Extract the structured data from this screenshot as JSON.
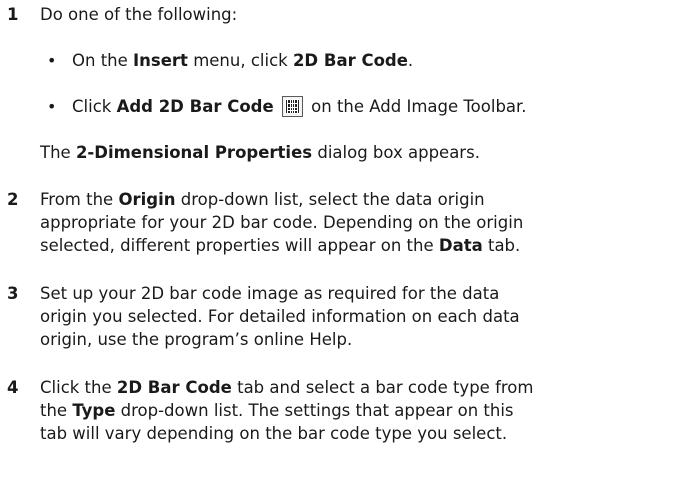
{
  "step1": {
    "number": "1",
    "text": "Do one of the following:",
    "bullet_symbol": "•",
    "bullet_a": {
      "part1": "On the ",
      "bold1": "Insert",
      "part2": " menu, click ",
      "bold2": "2D Bar Code",
      "part3": "."
    },
    "bullet_b": {
      "part1": "Click ",
      "bold1": "Add 2D Bar Code",
      "icon": "barcode-icon",
      "part2": " on the Add Image Toolbar."
    },
    "after": {
      "part1": "The ",
      "bold1": "2-Dimensional Properties",
      "part2": " dialog box appears."
    }
  },
  "step2": {
    "number": "2",
    "line1": {
      "part1": "From the ",
      "bold1": "Origin",
      "part2": " drop-down list, select the data origin"
    },
    "line2": "appropriate for your 2D bar code. Depending on the origin",
    "line3": {
      "part1": "selected, different properties will appear on the ",
      "bold1": "Data",
      "part2": " tab."
    }
  },
  "step3": {
    "number": "3",
    "line1": "Set up your 2D bar code image as required for the data",
    "line2": "origin you selected. For detailed information on each data",
    "line3": "origin, use the program’s online Help."
  },
  "step4": {
    "number": "4",
    "line1": {
      "part1": "Click the ",
      "bold1": "2D Bar Code",
      "part2": " tab and select a bar code type from"
    },
    "line2": {
      "part1": "the ",
      "bold1": "Type",
      "part2": " drop-down list. The settings that appear on this"
    },
    "line3": "tab will vary depending on the bar code type you select."
  }
}
